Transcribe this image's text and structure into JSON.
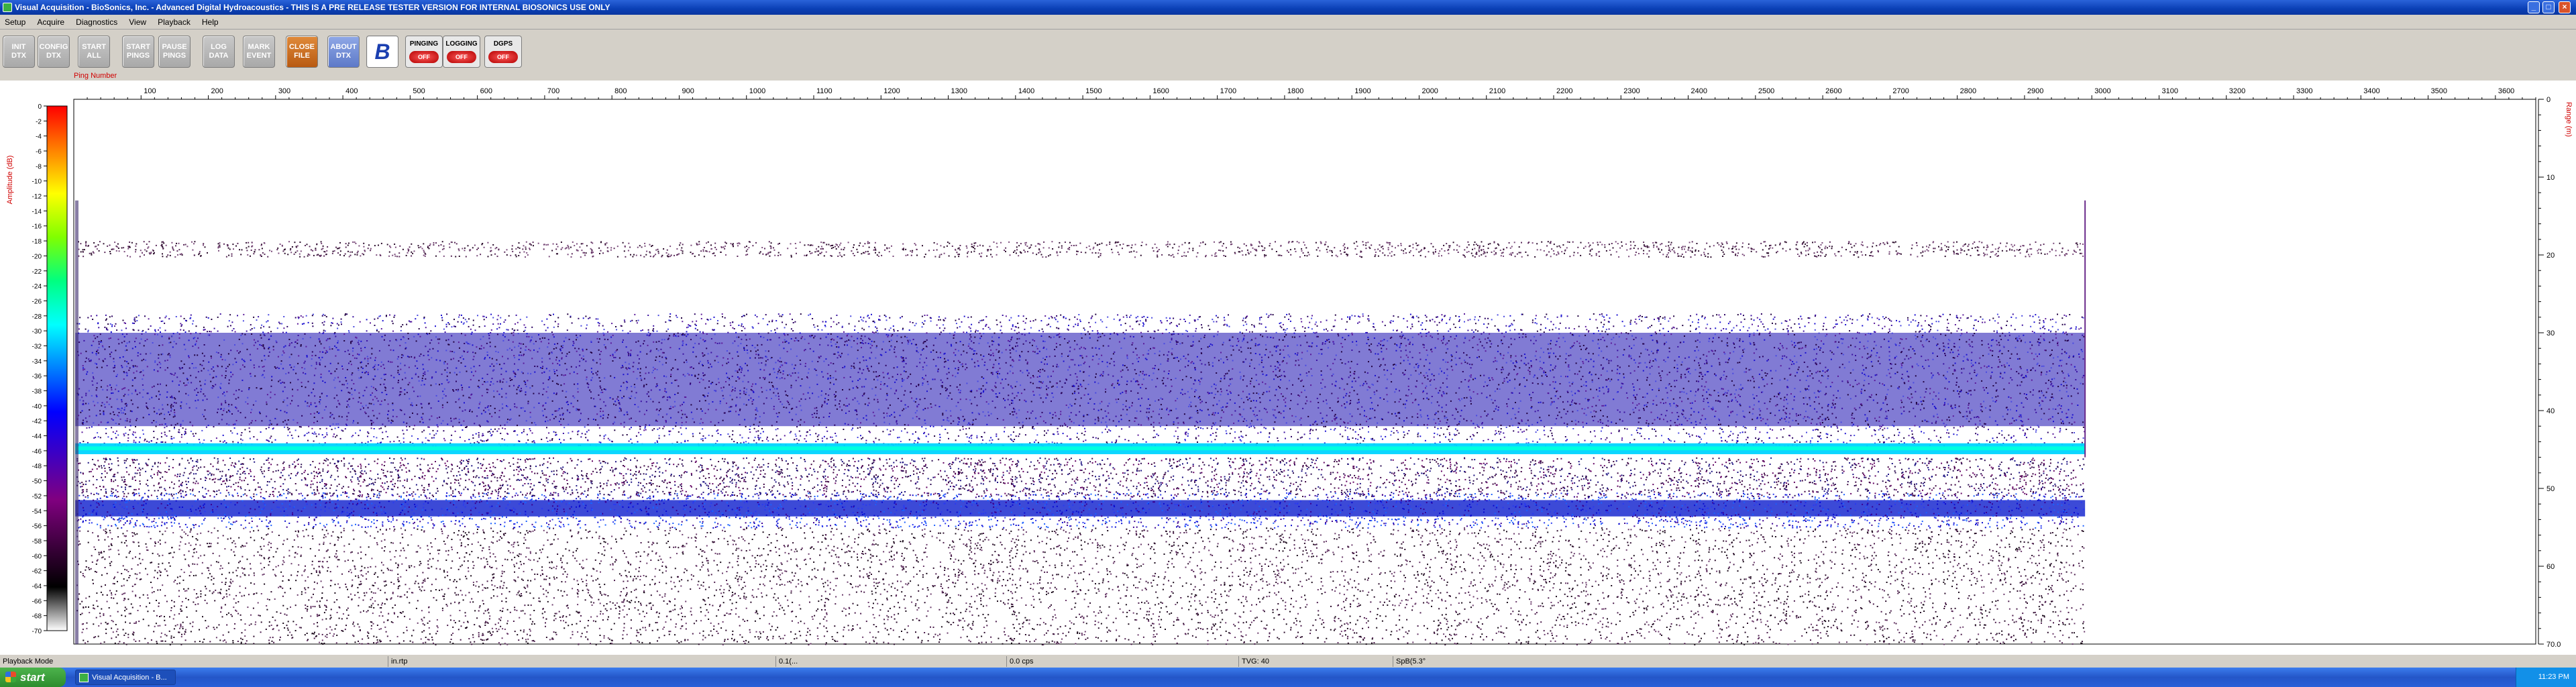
{
  "window": {
    "title": "Visual Acquisition  -  BioSonics, Inc.  -  Advanced Digital Hydroacoustics  -  THIS IS A PRE RELEASE TESTER VERSION FOR INTERNAL BIOSONICS USE ONLY",
    "minimize": "_",
    "maximize": "□",
    "close": "×"
  },
  "menu": [
    "Setup",
    "Acquire",
    "Diagnostics",
    "View",
    "Playback",
    "Help"
  ],
  "toolbar": {
    "buttons": [
      {
        "label": "INIT\nDTX"
      },
      {
        "label": "CONFIG\nDTX"
      },
      {
        "label": "START\nALL"
      },
      {
        "label": "START\nPINGS"
      },
      {
        "label": "PAUSE\nPINGS"
      },
      {
        "label": "LOG\nDATA"
      },
      {
        "label": "MARK\nEVENT"
      },
      {
        "label": "CLOSE\nFILE"
      },
      {
        "label": "ABOUT\nDTX"
      }
    ],
    "logo": "B",
    "indicators": [
      {
        "label": "PINGING",
        "state": "OFF"
      },
      {
        "label": "LOGGING",
        "state": "OFF"
      },
      {
        "label": "DGPS",
        "state": "OFF"
      }
    ]
  },
  "echogram": {
    "x_axis_title": "Ping Number",
    "x_ticks": [
      100,
      200,
      300,
      400,
      500,
      600,
      700,
      800,
      900,
      1000,
      1100,
      1200,
      1300,
      1400,
      1500,
      1600,
      1700,
      1800,
      1900,
      2000,
      2100,
      2200,
      2300,
      2400,
      2500,
      2600,
      2700,
      2800,
      2900,
      3000,
      3100,
      3200,
      3300,
      3400,
      3500,
      3600
    ],
    "x_range": [
      0,
      3660
    ],
    "data_end_ping": 2990,
    "amp_axis_title": "Amplitude (dB)",
    "amp_ticks": [
      0,
      -2,
      -4,
      -6,
      -8,
      -10,
      -12,
      -14,
      -16,
      -18,
      -20,
      -22,
      -24,
      -26,
      -28,
      -30,
      -32,
      -34,
      -36,
      -38,
      -40,
      -42,
      -44,
      -46,
      -48,
      -50,
      -52,
      -54,
      -56,
      -58,
      -60,
      -62,
      -64,
      -66,
      -68,
      -70
    ],
    "range_axis_title": "Range (m)",
    "range_ticks": [
      "0",
      "10",
      "20",
      "30",
      "40",
      "50",
      "60",
      "70.0"
    ],
    "range_max_m": 70,
    "colors": {
      "scale": [
        "#ff0000",
        "#ff8000",
        "#ffff00",
        "#80ff00",
        "#00ff80",
        "#00ffff",
        "#0080ff",
        "#0000ff",
        "#4000c0",
        "#800080",
        "#400040",
        "#000000",
        "#ffffff"
      ],
      "axis_title": "#d00000"
    }
  },
  "status": {
    "mode": "Playback Mode",
    "file": "in.rtp",
    "ping": "0.1(...",
    "time": "0.0 cps",
    "tvg": "TVG: 40",
    "sp": "SpB(5.3°"
  },
  "taskbar": {
    "start": "start",
    "task": "Visual Acquisition - B...",
    "clock": "11:23 PM"
  }
}
